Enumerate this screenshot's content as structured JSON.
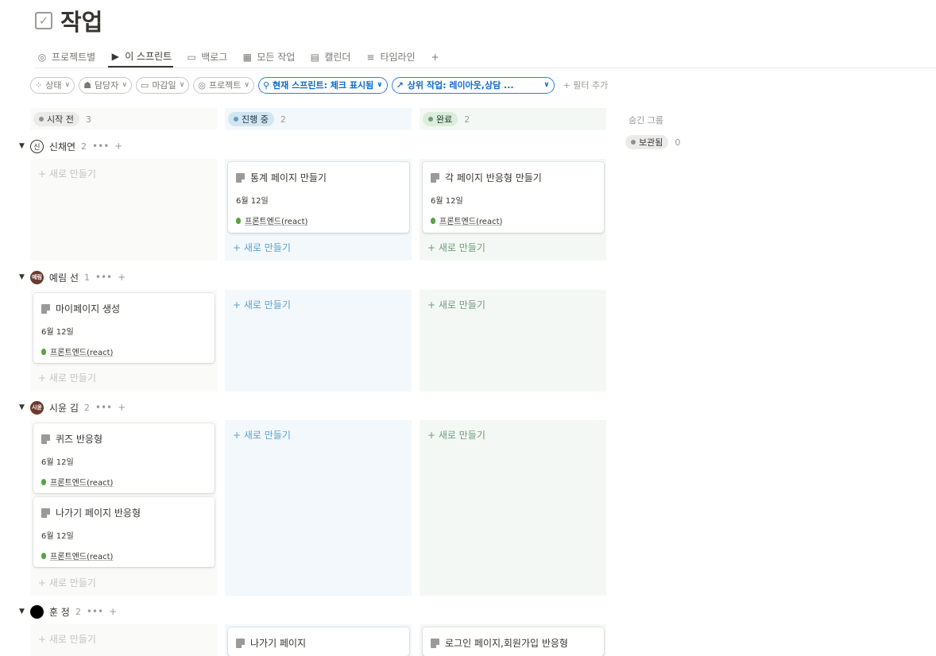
{
  "page": {
    "title": "작업"
  },
  "tabs": [
    {
      "icon": "◎",
      "label": "프로젝트별"
    },
    {
      "icon": "▶",
      "label": "이 스프린트"
    },
    {
      "icon": "▭",
      "label": "백로그"
    },
    {
      "icon": "▦",
      "label": "모든 작업"
    },
    {
      "icon": "▤",
      "label": "캘린더"
    },
    {
      "icon": "≡",
      "label": "타임라인"
    },
    {
      "icon": "+",
      "label": ""
    }
  ],
  "filters": [
    {
      "icon": "⁘",
      "label": "상태"
    },
    {
      "icon": "☗",
      "label": "담당자"
    },
    {
      "icon": "▭",
      "label": "마감일"
    },
    {
      "icon": "◎",
      "label": "프로젝트"
    },
    {
      "icon": "🔍",
      "label": "현재 스프린트: 체크 표시됨"
    },
    {
      "icon": "↗",
      "label": "상위 작업: 레이아웃,상담 ..."
    }
  ],
  "add_filter": "+ 필터 추가",
  "columns": [
    {
      "label": "시작 전",
      "count": "3"
    },
    {
      "label": "진행 중",
      "count": "2"
    },
    {
      "label": "완료",
      "count": "2"
    }
  ],
  "hidden_groups": {
    "label": "숨긴 그룹",
    "item": "보관됨",
    "count": "0"
  },
  "new_label": "+ 새로 만들기",
  "groups": [
    {
      "avatar": "신",
      "name": "신채연",
      "count": "2"
    },
    {
      "avatar": "예림",
      "name": "예림 선",
      "count": "1"
    },
    {
      "avatar": "시윤",
      "name": "시윤 김",
      "count": "2"
    },
    {
      "avatar": "",
      "name": "훈 정",
      "count": "2"
    }
  ],
  "cards": [
    {
      "title": "통계 페이지 만들기",
      "date": "6월 12일",
      "tag": "프론트엔드(react)"
    },
    {
      "title": "각 페이지 반응형 만들기",
      "date": "6월 12일",
      "tag": "프론트엔드(react)"
    },
    {
      "title": "마이페이지 생성",
      "date": "6월 12일",
      "tag": "프론트엔드(react)"
    },
    {
      "title": "퀴즈 반응형",
      "date": "6월 12일",
      "tag": "프론트엔드(react)"
    },
    {
      "title": "나가기 페이지 반응형",
      "date": "6월 12일",
      "tag": "프론트엔드(react)"
    },
    {
      "title": "나가기 페이지",
      "date": "",
      "tag": ""
    },
    {
      "title": "로그인 페이지,회원가입 반응형",
      "date": "",
      "tag": ""
    }
  ],
  "colors": {
    "todo_bg": "#fafaf9",
    "progress_bg": "#f3f8fc",
    "done_bg": "#f4f8f4",
    "filter_accent": "#2f7ee6"
  }
}
